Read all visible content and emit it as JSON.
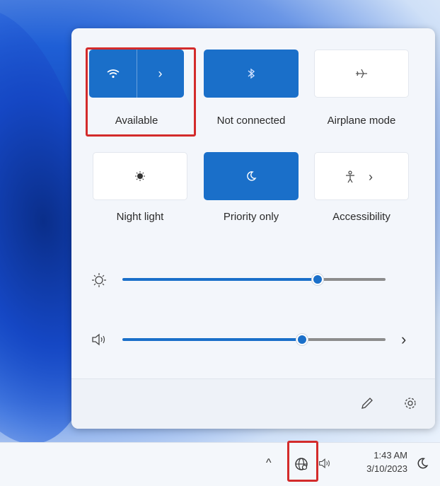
{
  "panel": {
    "tiles": [
      {
        "label": "Available",
        "icon": "wifi-icon",
        "secondary_icon": "chevron-right-icon",
        "active": true
      },
      {
        "label": "Not connected",
        "icon": "bluetooth-icon",
        "active": true
      },
      {
        "label": "Airplane mode",
        "icon": "airplane-icon",
        "active": false
      },
      {
        "label": "Night light",
        "icon": "night-light-icon",
        "active": false
      },
      {
        "label": "Priority only",
        "icon": "focus-moon-icon",
        "active": true
      },
      {
        "label": "Accessibility",
        "icon": "accessibility-icon",
        "secondary_icon": "chevron-right-icon",
        "active": false
      }
    ],
    "brightness": {
      "icon": "brightness-icon",
      "level_percent": 75
    },
    "volume": {
      "icon": "speaker-icon",
      "level_percent": 68
    },
    "footer": {
      "edit_icon": "pencil-icon",
      "settings_icon": "gear-icon"
    }
  },
  "taskbar": {
    "time": "1:43 AM",
    "date": "3/10/2023",
    "icons": [
      "chevron-up-icon",
      "network-globe-icon",
      "speaker-icon",
      "focus-moon-icon"
    ]
  },
  "colors": {
    "accent": "#1a6fc9",
    "highlight": "#d32b2b"
  }
}
